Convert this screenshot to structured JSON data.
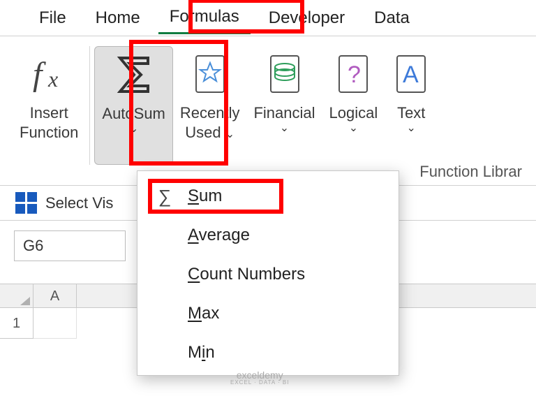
{
  "tabs": {
    "file": "File",
    "home": "Home",
    "formulas": "Formulas",
    "developer": "Developer",
    "data": "Data"
  },
  "ribbon": {
    "insert_function_l1": "Insert",
    "insert_function_l2": "Function",
    "autosum": "AutoSum",
    "recently_l1": "Recently",
    "recently_l2": "Used",
    "financial": "Financial",
    "logical": "Logical",
    "text": "Text",
    "group_label": "Function Librar"
  },
  "quickbar": {
    "select_vis": "Select Vis"
  },
  "dropdown": {
    "sum": "Sum",
    "average": "Average",
    "count": "Count Numbers",
    "max": "Max",
    "min": "Min"
  },
  "namebox": "G6",
  "columns": [
    "A"
  ],
  "rows": [
    "1"
  ],
  "watermark": {
    "main": "exceldemy",
    "sub": "EXCEL · DATA · BI"
  }
}
